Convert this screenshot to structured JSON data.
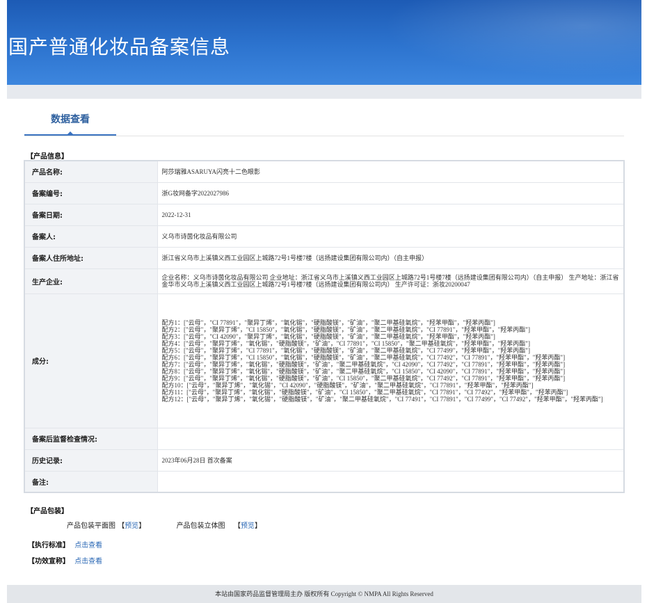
{
  "header": {
    "title": "国产普通化妆品备案信息"
  },
  "tabs": [
    {
      "label": "数据查看"
    }
  ],
  "product_info": {
    "heading": "【产品信息】",
    "rows": [
      {
        "label": "产品名称:",
        "value": "阿莎瑞雅ASARUYA闪亮十二色眼影"
      },
      {
        "label": "备案编号:",
        "value": "浙G妆网备字2022027986"
      },
      {
        "label": "备案日期:",
        "value": "2022-12-31"
      },
      {
        "label": "备案人:",
        "value": "义乌市诗茵化妆品有限公司"
      },
      {
        "label": "备案人住所地址:",
        "value": "浙江省义乌市上溪镇义西工业园区上城路72号1号楼7楼（远扬建设集团有限公司内）（自主申报）"
      },
      {
        "label": "生产企业:",
        "value": "企业名称：义乌市诗茵化妆品有限公司 企业地址：浙江省义乌市上溪镇义西工业园区上城路72号1号楼7楼（远扬建设集团有限公司内）（自主申报） 生产地址：浙江省金华市义乌市上溪镇义西工业园区上城路72号1号楼7楼（远扬建设集团有限公司内） 生产许可证：浙妆20200047"
      },
      {
        "label": "成分:",
        "formulas": [
          "配方1：[\"云母\"，\"CI 77891\"，\"聚异丁烯\"，\"氧化锡\"，\"硬脂酸镁\"，\"矿油\"，\"聚二甲基硅氧烷\"，\"羟苯甲酯\"，\"羟苯丙酯\"]",
          "配方2：[\"云母\"，\"聚异丁烯\"，\"CI 15850\"，\"氧化锡\"，\"硬脂酸镁\"，\"矿油\"，\"聚二甲基硅氧烷\"，\"CI 77891\"，\"羟苯甲酯\"，\"羟苯丙酯\"]",
          "配方3：[\"云母\"，\"CI 42090\"，\"聚异丁烯\"，\"氧化锡\"，\"硬脂酸镁\"，\"矿油\"，\"聚二甲基硅氧烷\"，\"羟苯甲酯\"，\"羟苯丙酯\"]",
          "配方4：[\"云母\"，\"聚异丁烯\"，\"氧化锡\"，\"硬脂酸镁\"，\"矿油\"，\"CI 77891\"，\"CI 15850\"，\"聚二甲基硅氧烷\"，\"羟苯甲酯\"，\"羟苯丙酯\"]",
          "配方5：[\"云母\"，\"聚异丁烯\"，\"CI 77891\"，\"氧化锡\"，\"硬脂酸镁\"，\"矿油\"，\"聚二甲基硅氧烷\"，\"CI 77499\"，\"羟苯甲酯\"，\"羟苯丙酯\"]",
          "配方6：[\"云母\"，\"聚异丁烯\"，\"CI 15850\"，\"氧化锡\"，\"硬脂酸镁\"，\"矿油\"，\"聚二甲基硅氧烷\"，\"CI 77492\"，\"CI 77891\"，\"羟苯甲酯\"，\"羟苯丙酯\"]",
          "配方7：[\"云母\"，\"聚异丁烯\"，\"氧化锡\"，\"硬脂酸镁\"，\"矿油\"，\"聚二甲基硅氧烷\"，\"CI 42090\"，\"CI 77492\"，\"CI 77891\"，\"羟苯甲酯\"，\"羟苯丙酯\"]",
          "配方8：[\"云母\"，\"聚异丁烯\"，\"氧化锡\"，\"硬脂酸镁\"，\"矿油\"，\"聚二甲基硅氧烷\"，\"CI 15850\"，\"CI 42090\"，\"CI 77891\"，\"羟苯甲酯\"，\"羟苯丙酯\"]",
          "配方9：[\"云母\"，\"聚异丁烯\"，\"氧化锡\"，\"硬脂酸镁\"，\"矿油\"，\"CI 15850\"，\"聚二甲基硅氧烷\"，\"CI 77492\"，\"CI 77891\"，\"羟苯甲酯\"，\"羟苯丙酯\"]",
          "配方10：[\"云母\"，\"聚异丁烯\"，\"氧化锡\"，\"CI 42090\"，\"硬脂酸镁\"，\"矿油\"，\"聚二甲基硅氧烷\"，\"CI 77891\"，\"羟苯甲酯\"，\"羟苯丙酯\"]",
          "配方11：[\"云母\"，\"聚异丁烯\"，\"氧化锡\"，\"硬脂酸镁\"，\"矿油\"，\"CI 15850\"，\"聚二甲基硅氧烷\"，\"CI 77891\"，\"CI 77492\"，\"羟苯甲酯\"，\"羟苯丙酯\"]",
          "配方12：[\"云母\"，\"聚异丁烯\"，\"氧化锡\"，\"硬脂酸镁\"，\"矿油\"，\"聚二甲基硅氧烷\"，\"CI 77491\"，\"CI 77891\"，\"CI 77499\"，\"CI 77492\"，\"羟苯甲酯\"，\"羟苯丙酯\"]"
        ]
      },
      {
        "label": "备案后监督检查情况:",
        "value": ""
      },
      {
        "label": "历史记录:",
        "value": "2023年06月28日 首次备案"
      },
      {
        "label": "备注:",
        "value": ""
      }
    ]
  },
  "packaging": {
    "heading": "【产品包装】",
    "flat_label": "产品包装平面图",
    "stereo_label": "产品包装立体图",
    "bracket_open": "【",
    "bracket_close": "】",
    "preview_label": "预览"
  },
  "standard": {
    "heading": "【执行标准】",
    "link": "点击查看"
  },
  "efficacy": {
    "heading": "【功效宣称】",
    "link": "点击查看"
  },
  "footer": {
    "text": "本站由国家药品监督管理局主办 版权所有 Copyright © NMPA All Rights Reserved"
  },
  "colors": {
    "banner": "#2d74cf",
    "link": "#2b68b5",
    "label_bg": "#f1f3f6"
  }
}
